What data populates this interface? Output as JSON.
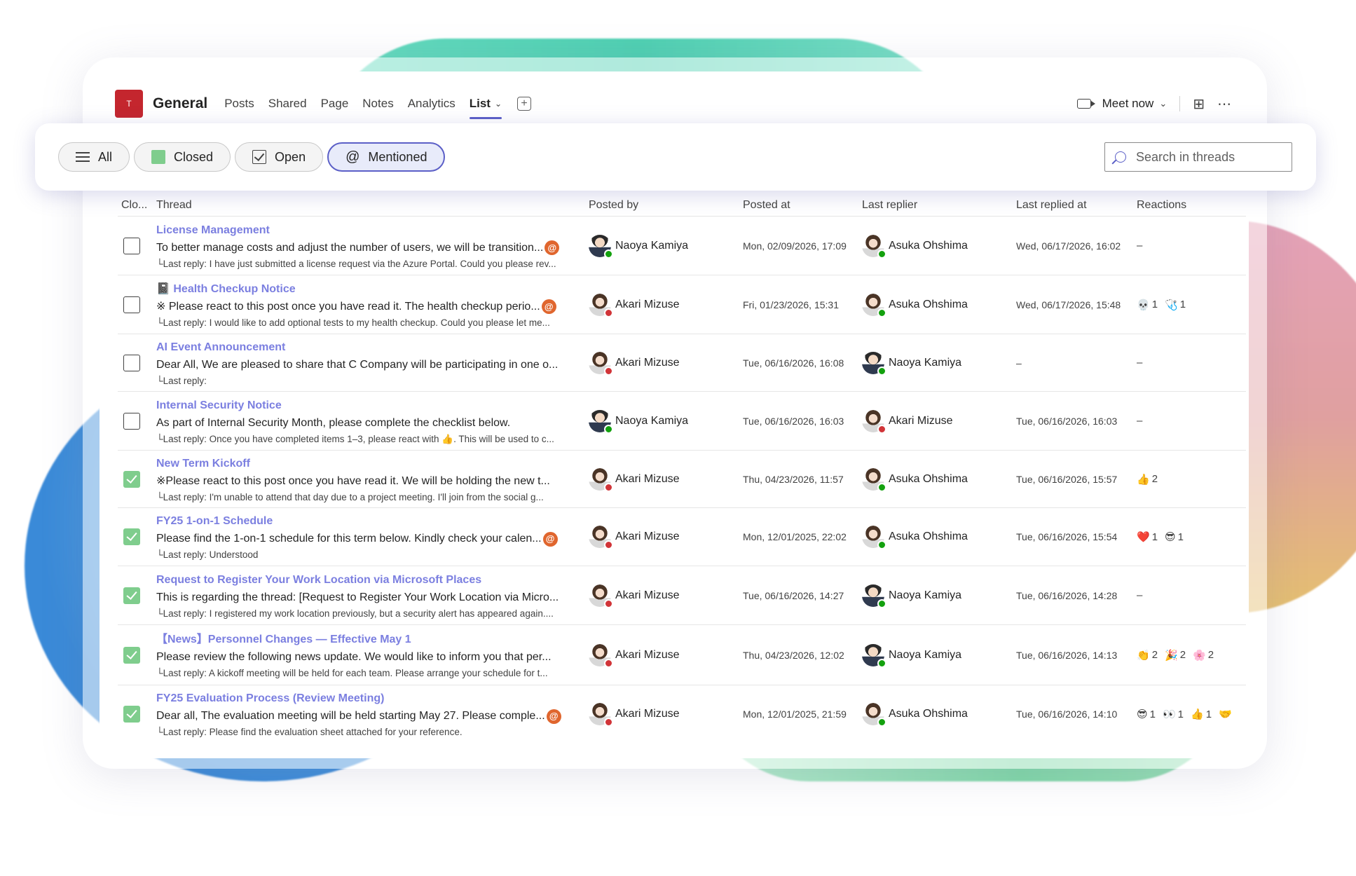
{
  "header": {
    "team_initial": "T",
    "channel": "General",
    "tabs": [
      "Posts",
      "Shared",
      "Page",
      "Notes",
      "Analytics"
    ],
    "active_tab": "List",
    "meet_now": "Meet now",
    "icons": [
      "video-camera-icon",
      "chevron-down-icon",
      "apps-icon",
      "more-icon",
      "add-tab-icon"
    ]
  },
  "filters": {
    "all": "All",
    "closed": "Closed",
    "open": "Open",
    "mentioned": "Mentioned",
    "active": "Mentioned",
    "search_placeholder": "Search in threads"
  },
  "columns": {
    "closed": "Clo...",
    "thread": "Thread",
    "posted_by": "Posted by",
    "posted_at": "Posted at",
    "last_replier": "Last replier",
    "last_replied_at": "Last replied at",
    "reactions": "Reactions"
  },
  "colors": {
    "accent": "#5b5fc7",
    "title_link": "#7b7fe0",
    "mention": "#e0662e",
    "checked": "#7fcd8d",
    "online": "#13a10e",
    "busy": "#d13438"
  },
  "rows": [
    {
      "closed": false,
      "title": "License Management",
      "body": "To better manage costs and adjust the number of users, we will be transition...",
      "mention": true,
      "reply": "└Last reply: I have just submitted a license request via the Azure Portal. Could you please rev...",
      "posted_by": "Naoya Kamiya",
      "posted_by_gender": "m",
      "posted_by_status": "g",
      "posted_at": "Mon, 02/09/2026, 17:09",
      "replier": "Asuka Ohshima",
      "replier_gender": "f",
      "replier_status": "g",
      "replied_at": "Wed, 06/17/2026, 16:02",
      "reactions": [
        {
          "emoji": "–",
          "count": ""
        }
      ]
    },
    {
      "closed": false,
      "title": "📓 Health Checkup Notice",
      "body": "※ Please react to this post once you have read it. The health checkup perio...",
      "mention": true,
      "reply": "└Last reply: I would like to add optional tests to my health checkup. Could you please let me...",
      "posted_by": "Akari Mizuse",
      "posted_by_gender": "f",
      "posted_by_status": "r",
      "posted_at": "Fri, 01/23/2026, 15:31",
      "replier": "Asuka Ohshima",
      "replier_gender": "f",
      "replier_status": "g",
      "replied_at": "Wed, 06/17/2026, 15:48",
      "reactions": [
        {
          "emoji": "💀",
          "count": "1"
        },
        {
          "emoji": "🩺",
          "count": "1"
        }
      ]
    },
    {
      "closed": false,
      "title": "AI Event Announcement",
      "body": "Dear All, We are pleased to share that C Company will be participating in one o...",
      "mention": false,
      "reply": "└Last reply:",
      "posted_by": "Akari Mizuse",
      "posted_by_gender": "f",
      "posted_by_status": "r",
      "posted_at": "Tue, 06/16/2026, 16:08",
      "replier": "Naoya Kamiya",
      "replier_gender": "m",
      "replier_status": "g",
      "replied_at": "–",
      "reactions": [
        {
          "emoji": "–",
          "count": ""
        }
      ]
    },
    {
      "closed": false,
      "title": "Internal Security Notice",
      "body": "As part of Internal Security Month, please complete the checklist below.",
      "mention": false,
      "reply": "└Last reply: Once you have completed items 1–3, please react with 👍. This will be used to c...",
      "posted_by": "Naoya Kamiya",
      "posted_by_gender": "m",
      "posted_by_status": "g",
      "posted_at": "Tue, 06/16/2026, 16:03",
      "replier": "Akari Mizuse",
      "replier_gender": "f",
      "replier_status": "r",
      "replied_at": "Tue, 06/16/2026, 16:03",
      "reactions": [
        {
          "emoji": "–",
          "count": ""
        }
      ]
    },
    {
      "closed": true,
      "title": "New Term Kickoff",
      "body": "※Please react to this post once you have read it.   We will be holding the new t...",
      "mention": false,
      "reply": "└Last reply: I'm unable to attend that day due to a project meeting. I'll join from the social g...",
      "posted_by": "Akari Mizuse",
      "posted_by_gender": "f",
      "posted_by_status": "r",
      "posted_at": "Thu, 04/23/2026, 11:57",
      "replier": "Asuka Ohshima",
      "replier_gender": "f",
      "replier_status": "g",
      "replied_at": "Tue, 06/16/2026, 15:57",
      "reactions": [
        {
          "emoji": "👍",
          "count": "2"
        }
      ]
    },
    {
      "closed": true,
      "title": "FY25 1-on-1 Schedule",
      "body": "Please find the 1-on-1 schedule for this term below. Kindly check your calen...",
      "mention": true,
      "reply": "└Last reply: Understood",
      "posted_by": "Akari Mizuse",
      "posted_by_gender": "f",
      "posted_by_status": "r",
      "posted_at": "Mon, 12/01/2025, 22:02",
      "replier": "Asuka Ohshima",
      "replier_gender": "f",
      "replier_status": "g",
      "replied_at": "Tue, 06/16/2026, 15:54",
      "reactions": [
        {
          "emoji": "❤️",
          "count": "1"
        },
        {
          "emoji": "😎",
          "count": "1"
        }
      ]
    },
    {
      "closed": true,
      "title": "Request to Register Your Work Location via Microsoft Places",
      "body": "This is regarding the thread: [Request to Register Your Work Location via Micro...",
      "mention": false,
      "reply": "└Last reply: I registered my work location previously, but a security alert has appeared again....",
      "posted_by": "Akari Mizuse",
      "posted_by_gender": "f",
      "posted_by_status": "r",
      "posted_at": "Tue, 06/16/2026, 14:27",
      "replier": "Naoya Kamiya",
      "replier_gender": "m",
      "replier_status": "g",
      "replied_at": "Tue, 06/16/2026, 14:28",
      "reactions": [
        {
          "emoji": "–",
          "count": ""
        }
      ]
    },
    {
      "closed": true,
      "title": "【News】Personnel Changes — Effective May 1",
      "body": "Please review the following news update. We would like to inform you that per...",
      "mention": false,
      "reply": "└Last reply: A kickoff meeting will be held for each team. Please arrange your schedule for t...",
      "posted_by": "Akari Mizuse",
      "posted_by_gender": "f",
      "posted_by_status": "r",
      "posted_at": "Thu, 04/23/2026, 12:02",
      "replier": "Naoya Kamiya",
      "replier_gender": "m",
      "replier_status": "g",
      "replied_at": "Tue, 06/16/2026, 14:13",
      "reactions": [
        {
          "emoji": "👏",
          "count": "2"
        },
        {
          "emoji": "🎉",
          "count": "2"
        },
        {
          "emoji": "🌸",
          "count": "2"
        }
      ]
    },
    {
      "closed": true,
      "title": "FY25 Evaluation Process (Review Meeting)",
      "body": "Dear all, The evaluation meeting will be held starting May 27. Please comple...",
      "mention": true,
      "reply": "└Last reply: Please find the evaluation sheet attached for your reference.",
      "posted_by": "Akari Mizuse",
      "posted_by_gender": "f",
      "posted_by_status": "r",
      "posted_at": "Mon, 12/01/2025, 21:59",
      "replier": "Asuka Ohshima",
      "replier_gender": "f",
      "replier_status": "g",
      "replied_at": "Tue, 06/16/2026, 14:10",
      "reactions": [
        {
          "emoji": "😎",
          "count": "1"
        },
        {
          "emoji": "👀",
          "count": "1"
        },
        {
          "emoji": "👍",
          "count": "1"
        },
        {
          "emoji": "🤝",
          "count": ""
        }
      ]
    }
  ]
}
